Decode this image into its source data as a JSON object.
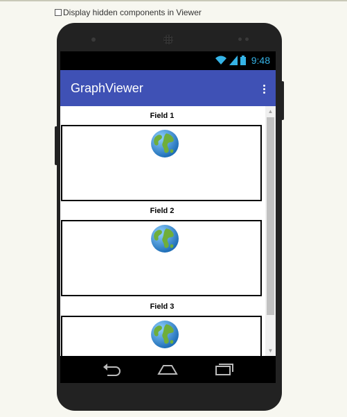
{
  "viewer": {
    "display_hidden_label": "Display hidden components in Viewer",
    "display_hidden_checked": false
  },
  "status_bar": {
    "time": "9:48",
    "icons": [
      "wifi-icon",
      "signal-icon",
      "battery-icon"
    ]
  },
  "app_bar": {
    "title": "GraphViewer",
    "menu_icon": "overflow-menu-icon"
  },
  "fields": [
    {
      "label": "Field 1",
      "icon": "globe-icon"
    },
    {
      "label": "Field 2",
      "icon": "globe-icon"
    },
    {
      "label": "Field 3",
      "icon": "globe-icon"
    }
  ],
  "nav_bar": {
    "buttons": [
      "back-icon",
      "home-icon",
      "recents-icon"
    ]
  },
  "colors": {
    "app_bar": "#3f51b5",
    "status_icons": "#35b3e6",
    "background": "#f7f7f0"
  }
}
